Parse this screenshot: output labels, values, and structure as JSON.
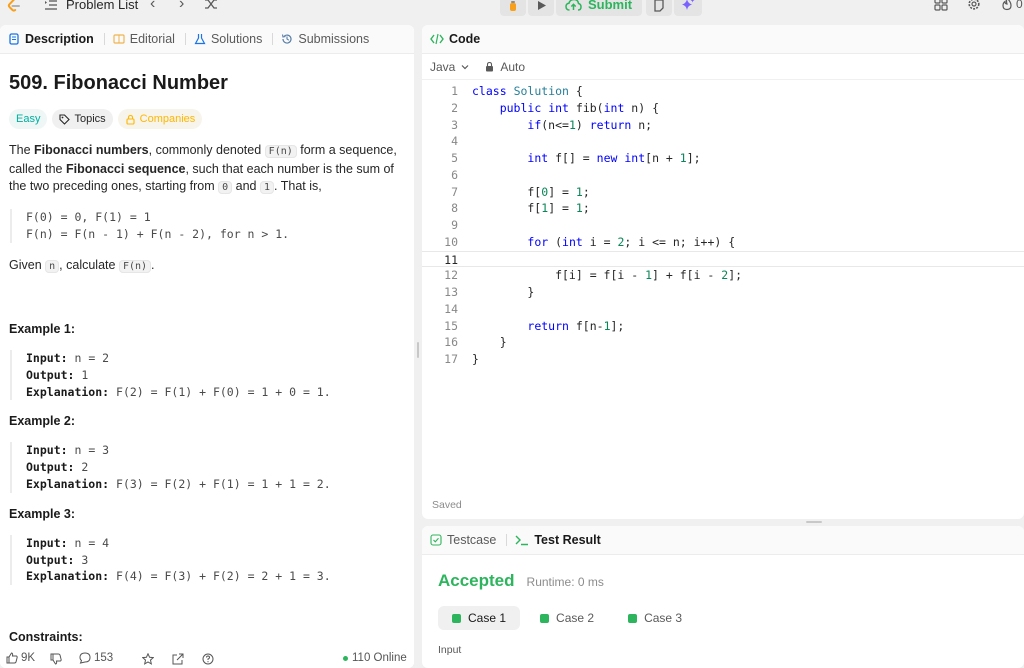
{
  "topbar": {
    "title": "Problem List",
    "submit_label": "Submit"
  },
  "left_tabs": [
    {
      "label": "Description"
    },
    {
      "label": "Editorial"
    },
    {
      "label": "Solutions"
    },
    {
      "label": "Submissions"
    }
  ],
  "problem": {
    "title": "509. Fibonacci Number",
    "difficulty": "Easy",
    "topics_label": "Topics",
    "companies_label": "Companies",
    "p1": {
      "t1": "The ",
      "b1": "Fibonacci numbers",
      "t2": ", commonly denoted ",
      "c1": "F(n)",
      "t3": " form a sequence, called the ",
      "b2": "Fibonacci sequence",
      "t4": ", such that each number is the sum of the two preceding ones, starting from ",
      "c2": "0",
      "t5": " and ",
      "c3": "1",
      "t6": ". That is,"
    },
    "formula": [
      "F(0) = 0, F(1) = 1",
      "F(n) = F(n - 1) + F(n - 2), for n > 1."
    ],
    "p2": {
      "t1": "Given ",
      "c1": "n",
      "t2": ", calculate ",
      "c2": "F(n)",
      "t3": "."
    },
    "examples": [
      {
        "head": "Example 1:",
        "input_label": "Input:",
        "input": " n = 2",
        "output_label": "Output:",
        "output": " 1",
        "expl_label": "Explanation:",
        "expl": " F(2) = F(1) + F(0) = 1 + 0 = 1."
      },
      {
        "head": "Example 2:",
        "input_label": "Input:",
        "input": " n = 3",
        "output_label": "Output:",
        "output": " 2",
        "expl_label": "Explanation:",
        "expl": " F(3) = F(2) + F(1) = 1 + 1 = 2."
      },
      {
        "head": "Example 3:",
        "input_label": "Input:",
        "input": " n = 4",
        "output_label": "Output:",
        "output": " 3",
        "expl_label": "Explanation:",
        "expl": " F(4) = F(3) + F(2) = 2 + 1 = 3."
      }
    ],
    "constraints_head": "Constraints:"
  },
  "footer": {
    "likes": "9K",
    "comments": "153",
    "online": "110 Online"
  },
  "code": {
    "tab_label": "Code",
    "language": "Java",
    "mode": "Auto",
    "saved": "Saved",
    "current_line": 11,
    "lines": [
      "class Solution {",
      "    public int fib(int n) {",
      "        if(n<=1) return n;",
      "",
      "        int f[] = new int[n + 1];",
      "",
      "        f[0] = 1;",
      "        f[1] = 1;",
      "",
      "        for (int i = 2; i <= n; i++) {",
      "            ",
      "            f[i] = f[i - 1] + f[i - 2];",
      "        }",
      "",
      "        return f[n-1];",
      "    }",
      "}"
    ]
  },
  "result": {
    "tabs": [
      {
        "label": "Testcase"
      },
      {
        "label": "Test Result"
      }
    ],
    "status": "Accepted",
    "runtime": "Runtime: 0 ms",
    "cases": [
      {
        "label": "Case 1"
      },
      {
        "label": "Case 2"
      },
      {
        "label": "Case 3"
      }
    ],
    "input_label": "Input"
  },
  "colors": {
    "accepted": "#2db55d",
    "easy": "#00afa0",
    "companies": "#ffb700",
    "keyword": "#0000ff"
  }
}
